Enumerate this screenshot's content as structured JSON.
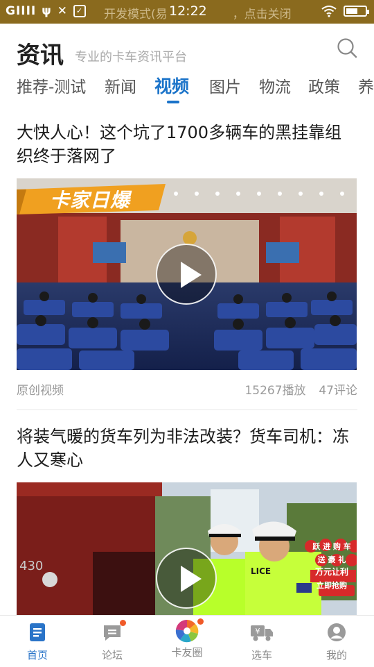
{
  "statusbar": {
    "signal_text": "GIIII",
    "developer_notice": "开发模式(易",
    "developer_notice_tail": "，点击关闭",
    "time": "12:22",
    "battery_level": 0.6
  },
  "header": {
    "brand": "资讯",
    "tagline": "专业的卡车资讯平台"
  },
  "tabs": [
    "推荐-测试",
    "新闻",
    "视频",
    "图片",
    "物流",
    "政策",
    "养"
  ],
  "active_tab": "视频",
  "articles": [
    {
      "title": "大快人心！这个坑了1700多辆车的黑挂靠组织终于落网了",
      "banner": "卡家日爆",
      "source": "原创视频",
      "plays": "15267播放",
      "comments": "47评论"
    },
    {
      "title": "将装气暖的货车列为非法改装？货车司机：冻人又寒心",
      "police_patch": "LICE",
      "plate": "430",
      "promo_lines": [
        "跃 进 购 车",
        "送 豪 礼",
        "万元让利",
        "立即抢购"
      ]
    }
  ],
  "bottom_nav": [
    {
      "label": "首页",
      "icon": "home-doc-icon",
      "active": true
    },
    {
      "label": "论坛",
      "icon": "forum-icon",
      "badge": true
    },
    {
      "label": "卡友圈",
      "icon": "pinwheel-icon",
      "badge": true
    },
    {
      "label": "选车",
      "icon": "truck-price-icon"
    },
    {
      "label": "我的",
      "icon": "profile-icon"
    }
  ],
  "colors": {
    "accent": "#1a73c9",
    "statusbar": "#8a6a1e",
    "badge": "#f05a28",
    "banner": "#f0a020"
  }
}
